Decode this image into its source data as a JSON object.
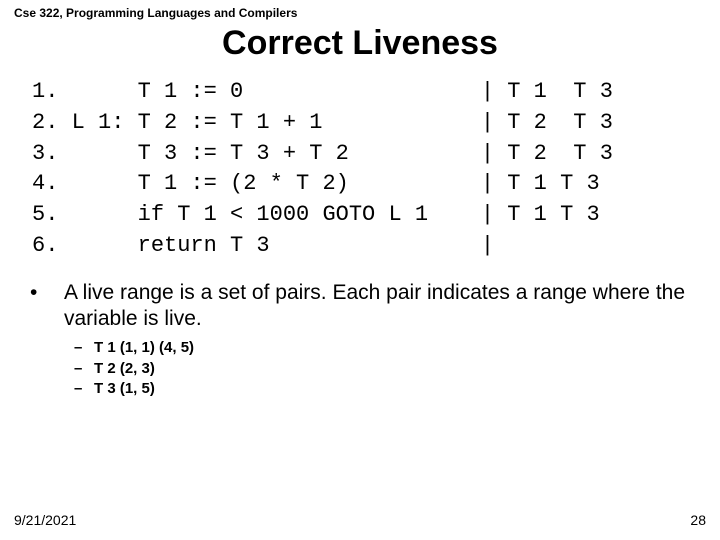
{
  "course": "Cse 322, Programming Languages and Compilers",
  "title": "Correct Liveness",
  "code_lines": [
    "1.      T 1 := 0                  | T 1  T 3",
    "2. L 1: T 2 := T 1 + 1            | T 2  T 3",
    "3.      T 3 := T 3 + T 2          | T 2  T 3",
    "4.      T 1 := (2 * T 2)          | T 1 T 3",
    "5.      if T 1 < 1000 GOTO L 1    | T 1 T 3",
    "6.      return T 3                |"
  ],
  "bullet_main": "A live range is a set of pairs. Each pair indicates a range where the variable is live.",
  "sub_items": [
    "T 1 (1, 1) (4, 5)",
    "T 2 (2, 3)",
    "T 3 (1, 5)"
  ],
  "footer_date": "9/21/2021",
  "footer_page": "28"
}
